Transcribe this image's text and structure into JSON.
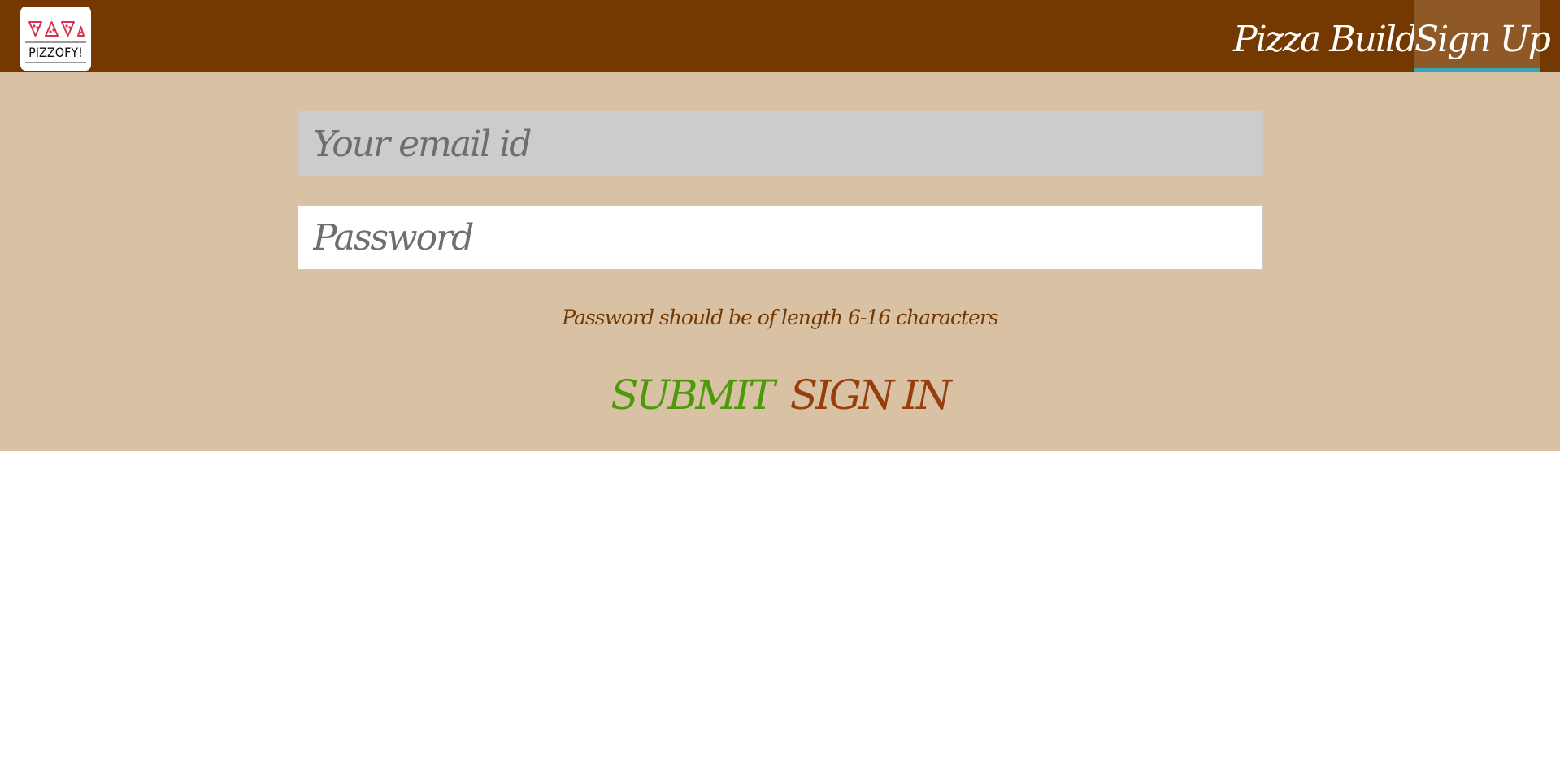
{
  "brand": {
    "logo_text": "PIZZOFY!",
    "logo_icon": "pizza-slices-icon",
    "logo_icon_color": "#d9304f"
  },
  "nav": {
    "items": [
      {
        "label": "Pizza Builder",
        "active": false
      },
      {
        "label": "Sign Up",
        "active": true
      }
    ]
  },
  "form": {
    "email_placeholder": "Your email id",
    "email_value": "",
    "password_placeholder": "Password",
    "password_value": "",
    "hint": "Password should be of length 6-16 characters",
    "submit_label": "SUBMIT",
    "signin_label": "SIGN IN"
  },
  "colors": {
    "navbar": "#733900",
    "active_tab": "#8e5927",
    "active_tab_underline": "#39a4b5",
    "form_background": "#d9c1a3",
    "submit": "#4c9a09",
    "signin": "#983e0c"
  }
}
